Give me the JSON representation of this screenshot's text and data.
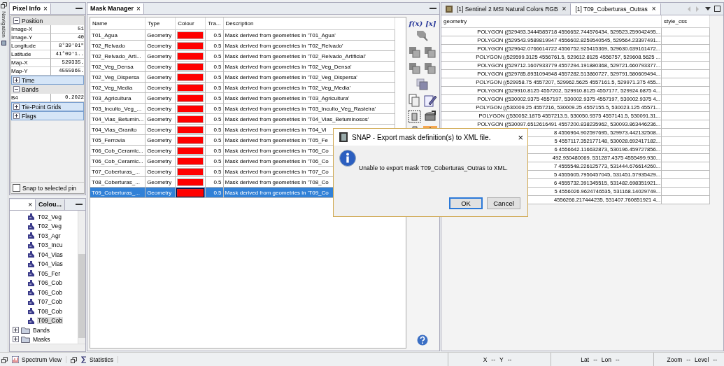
{
  "side_strip": {
    "label": "Navigation"
  },
  "pixel_info": {
    "tab": "Pixel Info",
    "close": "×",
    "sections": [
      {
        "title": "Position",
        "expanded": true,
        "rows": [
          {
            "name": "Image-X",
            "value": "51"
          },
          {
            "name": "Image-Y",
            "value": "40"
          },
          {
            "name": "Longitude",
            "value": "8°39'01\""
          },
          {
            "name": "Latitude",
            "value": "41°09'1.."
          },
          {
            "name": "Map-X",
            "value": "529335."
          },
          {
            "name": "Map-Y",
            "value": "4555965."
          }
        ]
      },
      {
        "title": "Time",
        "expanded": false
      },
      {
        "title": "Bands",
        "expanded": true,
        "rows": [
          {
            "name": "B4",
            "value": "0.2022"
          }
        ]
      },
      {
        "title": "Tie-Point Grids",
        "expanded": false
      },
      {
        "title": "Flags",
        "expanded": false
      }
    ],
    "snap": {
      "label": "Snap to selected pin",
      "checked": false
    }
  },
  "product_tree": {
    "tabs": [
      {
        "close": "×",
        "selected": true
      },
      {
        "label": "Colou...",
        "selected": false
      }
    ],
    "items": [
      {
        "label": "T02_Veg",
        "selected": false
      },
      {
        "label": "T02_Veg",
        "selected": false
      },
      {
        "label": "T03_Agr",
        "selected": false
      },
      {
        "label": "T03_Incu",
        "selected": false
      },
      {
        "label": "T04_Vias",
        "selected": false
      },
      {
        "label": "T04_Vias",
        "selected": false
      },
      {
        "label": "T05_Fer",
        "selected": false
      },
      {
        "label": "T06_Cob",
        "selected": false
      },
      {
        "label": "T06_Cob",
        "selected": false
      },
      {
        "label": "T07_Cob",
        "selected": false
      },
      {
        "label": "T08_Cob",
        "selected": false
      },
      {
        "label": "T09_Cob",
        "selected": true
      }
    ],
    "groups": [
      {
        "label": "Bands",
        "expanded": false
      },
      {
        "label": "Masks",
        "expanded": false
      }
    ]
  },
  "mask_manager": {
    "tab": "Mask Manager",
    "close": "×",
    "columns": [
      "Name",
      "Type",
      "Colour",
      "Tra...",
      "Description"
    ],
    "rows": [
      {
        "name": "T01_Agua",
        "type": "Geometry",
        "color": "#ff0000",
        "transparency": "0.5",
        "description": "Mask derived from geometries in 'T01_Agua'",
        "selected": false
      },
      {
        "name": "T02_Relvado",
        "type": "Geometry",
        "color": "#ff0000",
        "transparency": "0.5",
        "description": "Mask derived from geometries in 'T02_Relvado'",
        "selected": false
      },
      {
        "name": "T02_Relvado_Arti...",
        "type": "Geometry",
        "color": "#ff0000",
        "transparency": "0.5",
        "description": "Mask derived from geometries in 'T02_Relvado_Artificial'",
        "selected": false
      },
      {
        "name": "T02_Veg_Densa",
        "type": "Geometry",
        "color": "#ff0000",
        "transparency": "0.5",
        "description": "Mask derived from geometries in 'T02_Veg_Densa'",
        "selected": false
      },
      {
        "name": "T02_Veg_Dispersa",
        "type": "Geometry",
        "color": "#ff0000",
        "transparency": "0.5",
        "description": "Mask derived from geometries in 'T02_Veg_Dispersa'",
        "selected": false
      },
      {
        "name": "T02_Veg_Media",
        "type": "Geometry",
        "color": "#ff0000",
        "transparency": "0.5",
        "description": "Mask derived from geometries in 'T02_Veg_Media'",
        "selected": false
      },
      {
        "name": "T03_Agricultura",
        "type": "Geometry",
        "color": "#ff0000",
        "transparency": "0.5",
        "description": "Mask derived from geometries in 'T03_Agricultura'",
        "selected": false
      },
      {
        "name": "T03_Inculto_Veg_...",
        "type": "Geometry",
        "color": "#ff0000",
        "transparency": "0.5",
        "description": "Mask derived from geometries in 'T03_Inculto_Veg_Rasteira'",
        "selected": false
      },
      {
        "name": "T04_Vias_Betumin...",
        "type": "Geometry",
        "color": "#ff0000",
        "transparency": "0.5",
        "description": "Mask derived from geometries in 'T04_Vias_Betuminosos'",
        "selected": false
      },
      {
        "name": "T04_Vias_Granito",
        "type": "Geometry",
        "color": "#ff0000",
        "transparency": "0.5",
        "description": "Mask derived from geometries in 'T04_Vi",
        "selected": false
      },
      {
        "name": "T05_Ferrovia",
        "type": "Geometry",
        "color": "#ff0000",
        "transparency": "0.5",
        "description": "Mask derived from geometries in 'T05_Fe",
        "selected": false
      },
      {
        "name": "T06_Cob_Ceramic...",
        "type": "Geometry",
        "color": "#ff0000",
        "transparency": "0.5",
        "description": "Mask derived from geometries in 'T06_Co",
        "selected": false
      },
      {
        "name": "T06_Cob_Ceramic...",
        "type": "Geometry",
        "color": "#ff0000",
        "transparency": "0.5",
        "description": "Mask derived from geometries in 'T06_Co",
        "selected": false
      },
      {
        "name": "T07_Coberturas_...",
        "type": "Geometry",
        "color": "#ff0000",
        "transparency": "0.5",
        "description": "Mask derived from geometries in 'T07_Co",
        "selected": false
      },
      {
        "name": "T08_Coberturas_...",
        "type": "Geometry",
        "color": "#ff0000",
        "transparency": "0.5",
        "description": "Mask derived from geometries in 'T08_Co",
        "selected": false
      },
      {
        "name": "T09_Coberturas_...",
        "type": "Geometry",
        "color": "#ff0000",
        "transparency": "0.5",
        "description": "Mask derived from geometries in 'T09_Co",
        "selected": true
      }
    ],
    "tools": {
      "expression": "f(x)",
      "variable": "[x]"
    }
  },
  "view": {
    "tabs": [
      {
        "label": "[1] Sentinel 2 MSI Natural Colors RGB",
        "close": "×",
        "selected": false
      },
      {
        "label": "[1] T09_Coberturas_Outras",
        "close": "×",
        "selected": true
      }
    ],
    "columns": [
      "geometry",
      "style_css"
    ],
    "rows": [
      "POLYGON ((529493.3444585718 4556652.744576434, 529523.259042495...",
      "POLYGON ((529543.9589819947 4556602.8259540545, 529564.23397491...",
      "POLYGON ((529642.0766614722 4556752.925415369, 529630.639161472...",
      "POLYGON ((529599.3125 4556761.5, 529612.8125 4556757, 529608.5625 ...",
      "POLYGON ((529712.1607933779 4557294.191880368, 529721.660793377...",
      "POLYGON ((529785.8931094948 4557282.513860727, 529791.580609494...",
      "POLYGON ((529958.75 4557207, 529962.5625 4557161.5, 529971.375 455...",
      "POLYGON ((529910.8125 4557202, 529910.8125 4557177, 529924.6875 4...",
      "POLYGON ((530002.9375 4557197, 530002.9375 4557197, 530002.9375 4...",
      "POLYGON ((530009.25 4557216, 530009.25 4557155.5, 530023.125 45571...",
      "POLYGON ((530052.1875 4557213.5, 530050.9375 4557141.5, 530091.31...",
      "POLYGON ((530097.6512616491 4557200.838235962, 530093.863446236...",
      "8 4556964.902597695, 529973.442132508...",
      "5 4557117.352177148, 530028.692417182...",
      "6 4556642.116632873, 530196.459727856...",
      "492.930480069, 531287.4375 4555499.930...",
      "7 4555548.226125773, 531444.676614260...",
      "5 4555605.7956457045, 531451.57935429...",
      "6 4555732.391345515, 531482.698351921...",
      "5 4556026.9624746535, 531168.14029749...",
      "4556266.217444235, 531407.760851921 4..."
    ]
  },
  "dialog": {
    "title": "SNAP - Export mask definition(s) to XML file.",
    "close": "×",
    "message": "Unable to export mask T09_Coberturas_Outras to XML.",
    "buttons": [
      {
        "label": "OK",
        "default": true
      },
      {
        "label": "Cancel",
        "default": false
      }
    ]
  },
  "status_bar": {
    "tabs": [
      {
        "label": "Spectrum View"
      },
      {
        "label": "Statistics"
      }
    ],
    "groups": [
      [
        {
          "label": "X",
          "value": "--"
        },
        {
          "label": "Y",
          "value": "--"
        }
      ],
      [
        {
          "label": "Lat",
          "value": "--"
        },
        {
          "label": "Lon",
          "value": "--"
        }
      ],
      [
        {
          "label": "Zoom",
          "value": "--"
        },
        {
          "label": "Level",
          "value": "--"
        }
      ]
    ]
  }
}
